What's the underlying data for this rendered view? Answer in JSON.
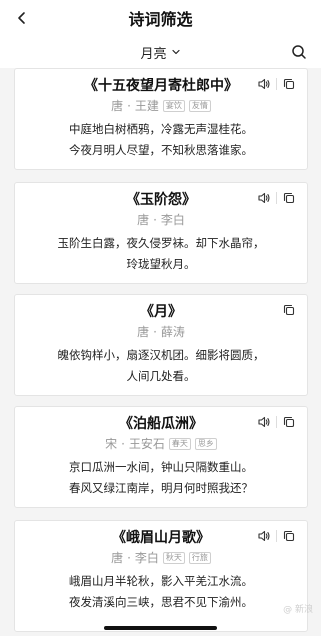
{
  "nav": {
    "title": "诗词筛选"
  },
  "filter": {
    "label": "月亮"
  },
  "poems": [
    {
      "title": "《十五夜望月寄杜郎中》",
      "dynasty": "唐",
      "author": "王建",
      "tags": [
        "宴饮",
        "友情"
      ],
      "lines": [
        "中庭地白树栖鸦，冷露无声湿桂花。",
        "今夜月明人尽望，不知秋思落谁家。"
      ],
      "has_audio": true
    },
    {
      "title": "《玉阶怨》",
      "dynasty": "唐",
      "author": "李白",
      "tags": [],
      "lines": [
        "玉阶生白露，夜久侵罗袜。却下水晶帘，",
        "玲珑望秋月。"
      ],
      "has_audio": true
    },
    {
      "title": "《月》",
      "dynasty": "唐",
      "author": "薛涛",
      "tags": [],
      "lines": [
        "魄依钩样小，扇逐汉机团。细影将圆质，",
        "人间几处看。"
      ],
      "has_audio": false
    },
    {
      "title": "《泊船瓜洲》",
      "dynasty": "宋",
      "author": "王安石",
      "tags": [
        "春天",
        "思乡"
      ],
      "lines": [
        "京口瓜洲一水间，钟山只隔数重山。",
        "春风又绿江南岸，明月何时照我还？"
      ],
      "has_audio": true
    },
    {
      "title": "《峨眉山月歌》",
      "dynasty": "唐",
      "author": "李白",
      "tags": [
        "秋天",
        "行旅"
      ],
      "lines": [
        "峨眉山月半轮秋，影入平羌江水流。",
        "夜发清溪向三峡，思君不见下渝州。"
      ],
      "has_audio": true
    }
  ],
  "watermark": "@ 新浪",
  "icons": {
    "back": "chevron-left-icon",
    "dropdown": "chevron-down-icon",
    "search": "search-icon",
    "audio": "speaker-icon",
    "copy": "copy-icon"
  }
}
